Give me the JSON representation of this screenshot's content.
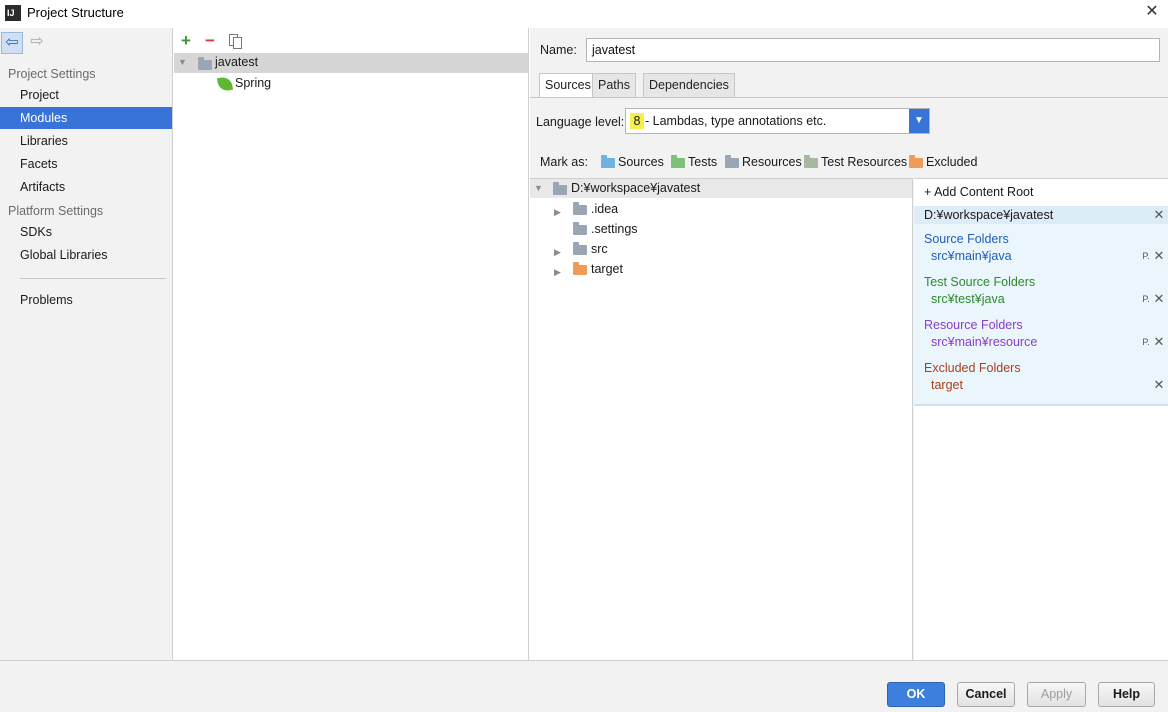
{
  "window": {
    "title": "Project Structure",
    "close_glyph": "✕"
  },
  "nav": {
    "back_glyph": "⇦",
    "forward_glyph": "⇨",
    "project_settings_header": "Project Settings",
    "platform_settings_header": "Platform Settings",
    "items": [
      {
        "label": "Project"
      },
      {
        "label": "Modules",
        "selected": true
      },
      {
        "label": "Libraries"
      },
      {
        "label": "Facets"
      },
      {
        "label": "Artifacts"
      },
      {
        "label": "SDKs"
      },
      {
        "label": "Global Libraries"
      },
      {
        "label": "Problems"
      }
    ]
  },
  "modules_tree": {
    "add_glyph": "+",
    "remove_glyph": "−",
    "root": {
      "label": "javatest",
      "arrow": "▼"
    },
    "children": [
      {
        "label": "Spring"
      }
    ]
  },
  "module": {
    "name_label": "Name:",
    "name_value": "javatest",
    "tabs": [
      "Sources",
      "Paths",
      "Dependencies"
    ],
    "active_tab": "Sources",
    "language_level_label": "Language level:",
    "language_level_number": "8",
    "language_level_text": "- Lambdas, type annotations etc.",
    "dropdown_arrow": "▼",
    "mark_as_label": "Mark as:",
    "mark_as": [
      {
        "label": "Sources",
        "color": "#6fb3e0"
      },
      {
        "label": "Tests",
        "color": "#7cc07a"
      },
      {
        "label": "Resources",
        "color": "#9aa6b3"
      },
      {
        "label": "Test Resources",
        "color": "#a8b8a0"
      },
      {
        "label": "Excluded",
        "color": "#f09b58"
      }
    ]
  },
  "content_tree": {
    "root": {
      "label": "D:¥workspace¥javatest",
      "arrow": "▼"
    },
    "items": [
      {
        "label": ".idea",
        "arrow": "▶"
      },
      {
        "label": ".settings",
        "arrow": ""
      },
      {
        "label": "src",
        "arrow": "▶"
      },
      {
        "label": "target",
        "arrow": "▶"
      }
    ]
  },
  "content_roots": {
    "add_label": "+ Add Content Root",
    "root_path": "D:¥workspace¥javatest",
    "remove_glyph": "✕",
    "props_glyph": "P.",
    "groups": [
      {
        "title": "Source Folders",
        "item": "src¥main¥java"
      },
      {
        "title": "Test Source Folders",
        "item": "src¥test¥java"
      },
      {
        "title": "Resource Folders",
        "item": "src¥main¥resource"
      },
      {
        "title": "Excluded Folders",
        "item": "target"
      }
    ]
  },
  "buttons": {
    "ok": "OK",
    "cancel": "Cancel",
    "apply": "Apply",
    "help": "Help"
  },
  "colors": {
    "accent": "#3874d8",
    "selection": "#3874d8",
    "panel_bg": "#f2f2f2"
  }
}
